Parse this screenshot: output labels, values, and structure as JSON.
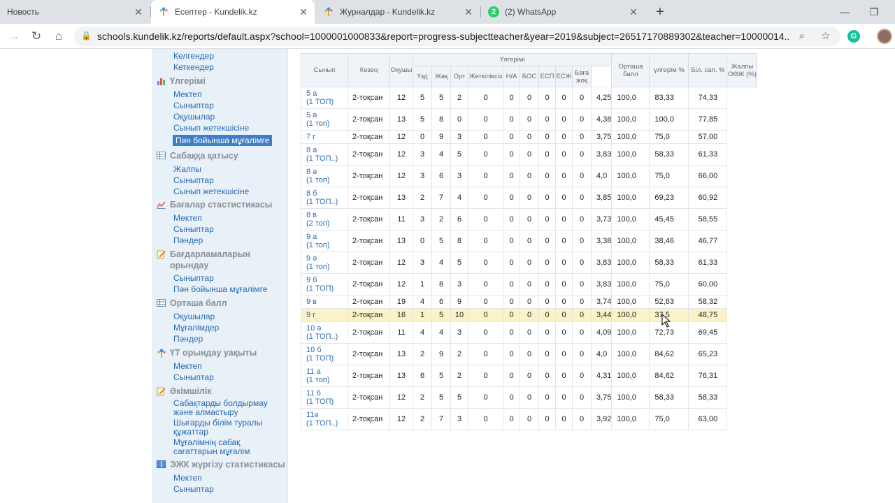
{
  "browser": {
    "tabs": [
      {
        "label": "Новость",
        "icon": "page-icon",
        "active": false
      },
      {
        "label": "Есептер - Kundelik.kz",
        "icon": "kundelik-icon",
        "active": true
      },
      {
        "label": "Журналдар - Kundelik.kz",
        "icon": "kundelik-icon",
        "active": false
      },
      {
        "label": "(2) WhatsApp",
        "icon": "whatsapp-icon",
        "active": false,
        "badge": "2"
      }
    ],
    "url": "schools.kundelik.kz/reports/default.aspx?school=1000001000833&report=progress-subjectteacher&year=2019&subject=2651717088930​2&teacher=10000014..."
  },
  "sidebar": {
    "top_links": [
      "Келгендер",
      "Кеткендер"
    ],
    "sections": [
      {
        "title": "Үлгерімі",
        "icon": "chart-icon",
        "items": [
          "Мектеп",
          "Сыныптар",
          "Оқушылар",
          "Сынып жетекшісіне",
          "Пән бойынша мұғалімге"
        ],
        "active_index": 4
      },
      {
        "title": "Сабаққа қатысу",
        "icon": "table-icon",
        "items": [
          "Жалпы",
          "Сыныптар",
          "Сынып жетекшісіне"
        ]
      },
      {
        "title": "Бағалар стастистикасы",
        "icon": "stats-icon",
        "items": [
          "Мектеп",
          "Сыныптар",
          "Пәндер"
        ]
      },
      {
        "title": "Бағдарламаларын орындау",
        "icon": "pencil-icon",
        "items": [
          "Сыныптар",
          "Пән бойынша мұғалімге"
        ]
      },
      {
        "title": "Орташа балл",
        "icon": "table-icon",
        "items": [
          "Оқушылар",
          "Мұғалімдер",
          "Пәндер"
        ]
      },
      {
        "title": "ҮТ орындау уақыты",
        "icon": "kundelik-icon",
        "items": [
          "Мектеп",
          "Сыныптар"
        ]
      },
      {
        "title": "Әкімшілік",
        "icon": "pencil-icon",
        "items": [
          "Сабақтарды болдырмау және алмастыру",
          "Шығарды білім туралы құжаттар",
          "Мұғалімнің сабақ сағаттарын мұғалім"
        ]
      },
      {
        "title": "ЭЖК жүргізу статистикасы",
        "icon": "book-icon",
        "items": [
          "Мектеп",
          "Сыныптар"
        ]
      }
    ]
  },
  "report": {
    "headers": {
      "class": "Сынып",
      "period": "Кезең",
      "students": "Оқушы",
      "progress_group": "Үлгерімі",
      "excellent": "Үзд",
      "good": "Жақ",
      "average": "Орт",
      "failing": "Жеткіліксіз",
      "na": "Н/А",
      "bos": "БОС",
      "esp": "ЕСП",
      "eszh": "ЕСЖ",
      "no_grade": "Баға жоқ",
      "avg_score": "Орташа балл",
      "progress_pct": "үлгерім %",
      "quality_pct": "Біл. сап. %",
      "total_pct": "Жалпы ОӨЖ (%)"
    },
    "rows": [
      {
        "cls": "5 а\n(1 ТОП)",
        "period": "2-тоқсан",
        "n": "12",
        "u": "5",
        "zh": "5",
        "o": "2",
        "f": "0",
        "na": "0",
        "bos": "0",
        "esp": "0",
        "esz": "0",
        "ng": "0",
        "avg": "4,25",
        "prog": "100,0",
        "qual": "83,33",
        "tot": "74,33"
      },
      {
        "cls": "5 ә\n(1 топ)",
        "period": "2-тоқсан",
        "n": "13",
        "u": "5",
        "zh": "8",
        "o": "0",
        "f": "0",
        "na": "0",
        "bos": "0",
        "esp": "0",
        "esz": "0",
        "ng": "0",
        "avg": "4,38",
        "prog": "100,0",
        "qual": "100,0",
        "tot": "77,85"
      },
      {
        "cls": "7 г",
        "period": "2-тоқсан",
        "n": "12",
        "u": "0",
        "zh": "9",
        "o": "3",
        "f": "0",
        "na": "0",
        "bos": "0",
        "esp": "0",
        "esz": "0",
        "ng": "0",
        "avg": "3,75",
        "prog": "100,0",
        "qual": "75,0",
        "tot": "57,00"
      },
      {
        "cls": "8 а\n(1 ТОП..)",
        "period": "2-тоқсан",
        "n": "12",
        "u": "3",
        "zh": "4",
        "o": "5",
        "f": "0",
        "na": "0",
        "bos": "0",
        "esp": "0",
        "esz": "0",
        "ng": "0",
        "avg": "3,83",
        "prog": "100,0",
        "qual": "58,33",
        "tot": "61,33"
      },
      {
        "cls": "8 ә\n(1 топ)",
        "period": "2-тоқсан",
        "n": "12",
        "u": "3",
        "zh": "6",
        "o": "3",
        "f": "0",
        "na": "0",
        "bos": "0",
        "esp": "0",
        "esz": "0",
        "ng": "0",
        "avg": "4,0",
        "prog": "100,0",
        "qual": "75,0",
        "tot": "66,00"
      },
      {
        "cls": "8 б\n(1 ТОП..)",
        "period": "2-тоқсан",
        "n": "13",
        "u": "2",
        "zh": "7",
        "o": "4",
        "f": "0",
        "na": "0",
        "bos": "0",
        "esp": "0",
        "esz": "0",
        "ng": "0",
        "avg": "3,85",
        "prog": "100,0",
        "qual": "69,23",
        "tot": "60,92"
      },
      {
        "cls": "8 в\n(2 топ)",
        "period": "2-тоқсан",
        "n": "11",
        "u": "3",
        "zh": "2",
        "o": "6",
        "f": "0",
        "na": "0",
        "bos": "0",
        "esp": "0",
        "esz": "0",
        "ng": "0",
        "avg": "3,73",
        "prog": "100,0",
        "qual": "45,45",
        "tot": "58,55"
      },
      {
        "cls": "9 а\n(1 топ)",
        "period": "2-тоқсан",
        "n": "13",
        "u": "0",
        "zh": "5",
        "o": "8",
        "f": "0",
        "na": "0",
        "bos": "0",
        "esp": "0",
        "esz": "0",
        "ng": "0",
        "avg": "3,38",
        "prog": "100,0",
        "qual": "38,46",
        "tot": "46,77"
      },
      {
        "cls": "9 ә\n(1 топ)",
        "period": "2-тоқсан",
        "n": "12",
        "u": "3",
        "zh": "4",
        "o": "5",
        "f": "0",
        "na": "0",
        "bos": "0",
        "esp": "0",
        "esz": "0",
        "ng": "0",
        "avg": "3,83",
        "prog": "100,0",
        "qual": "58,33",
        "tot": "61,33"
      },
      {
        "cls": "9 б\n(1 ТОП)",
        "period": "2-тоқсан",
        "n": "12",
        "u": "1",
        "zh": "8",
        "o": "3",
        "f": "0",
        "na": "0",
        "bos": "0",
        "esp": "0",
        "esz": "0",
        "ng": "0",
        "avg": "3,83",
        "prog": "100,0",
        "qual": "75,0",
        "tot": "60,00"
      },
      {
        "cls": "9 в",
        "period": "2-тоқсан",
        "n": "19",
        "u": "4",
        "zh": "6",
        "o": "9",
        "f": "0",
        "na": "0",
        "bos": "0",
        "esp": "0",
        "esz": "0",
        "ng": "0",
        "avg": "3,74",
        "prog": "100,0",
        "qual": "52,63",
        "tot": "58,32"
      },
      {
        "cls": "9 г",
        "period": "2-тоқсан",
        "n": "16",
        "u": "1",
        "zh": "5",
        "o": "10",
        "f": "0",
        "na": "0",
        "bos": "0",
        "esp": "0",
        "esz": "0",
        "ng": "0",
        "avg": "3,44",
        "prog": "100,0",
        "qual": "37,5",
        "tot": "48,75",
        "highlight": true
      },
      {
        "cls": "10 ә\n(1 ТОП..)",
        "period": "2-тоқсан",
        "n": "11",
        "u": "4",
        "zh": "4",
        "o": "3",
        "f": "0",
        "na": "0",
        "bos": "0",
        "esp": "0",
        "esz": "0",
        "ng": "0",
        "avg": "4,09",
        "prog": "100,0",
        "qual": "72,73",
        "tot": "69,45"
      },
      {
        "cls": "10 б\n(1 ТОП)",
        "period": "2-тоқсан",
        "n": "13",
        "u": "2",
        "zh": "9",
        "o": "2",
        "f": "0",
        "na": "0",
        "bos": "0",
        "esp": "0",
        "esz": "0",
        "ng": "0",
        "avg": "4,0",
        "prog": "100,0",
        "qual": "84,62",
        "tot": "65,23"
      },
      {
        "cls": "11 а\n(1 топ)",
        "period": "2-тоқсан",
        "n": "13",
        "u": "6",
        "zh": "5",
        "o": "2",
        "f": "0",
        "na": "0",
        "bos": "0",
        "esp": "0",
        "esz": "0",
        "ng": "0",
        "avg": "4,31",
        "prog": "100,0",
        "qual": "84,62",
        "tot": "76,31"
      },
      {
        "cls": "11 б\n(1 ТОП)",
        "period": "2-тоқсан",
        "n": "12",
        "u": "2",
        "zh": "5",
        "o": "5",
        "f": "0",
        "na": "0",
        "bos": "0",
        "esp": "0",
        "esz": "0",
        "ng": "0",
        "avg": "3,75",
        "prog": "100,0",
        "qual": "58,33",
        "tot": "58,33"
      },
      {
        "cls": "11ә\n(1 ТОП..)",
        "period": "2-тоқсан",
        "n": "12",
        "u": "2",
        "zh": "7",
        "o": "3",
        "f": "0",
        "na": "0",
        "bos": "0",
        "esp": "0",
        "esz": "0",
        "ng": "0",
        "avg": "3,92",
        "prog": "100,0",
        "qual": "75,0",
        "tot": "63,00"
      }
    ]
  },
  "colors": {
    "link": "#2a6bb3",
    "highlight": "#fcf2c7",
    "active_bg": "#3f7fc7",
    "sidebar_bg": "#e8f0f8"
  }
}
